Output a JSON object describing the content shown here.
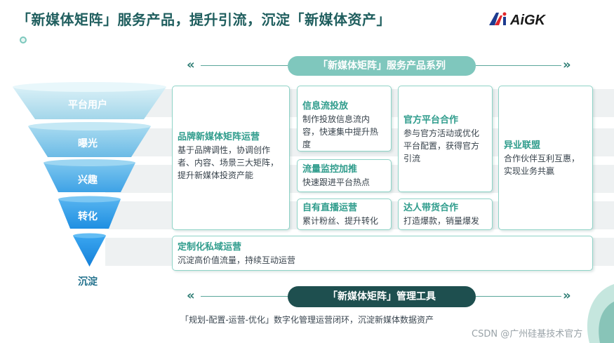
{
  "title": "「新媒体矩阵」服务产品，提升引流，沉淀「新媒体资产」",
  "logo_text": "AiGK",
  "funnel": [
    {
      "label": "平台用户"
    },
    {
      "label": "曝光"
    },
    {
      "label": "兴趣"
    },
    {
      "label": "转化"
    },
    {
      "label": "沉淀"
    }
  ],
  "top_banner": "「新媒体矩阵」服务产品系列",
  "cards": {
    "brand": {
      "title": "品牌新媒体矩阵运营",
      "desc": "基于品牌调性，协调创作者、内容、场景三大矩阵，提升新媒体投资产能"
    },
    "feed": {
      "title": "信息流投放",
      "desc": "制作投放信息流内容，快速集中提升热度"
    },
    "official": {
      "title": "官方平台合作",
      "desc": "参与官方活动或优化平台配置，获得官方引流"
    },
    "alliance": {
      "title": "异业联盟",
      "desc": "合作伙伴互利互惠，实现业务共赢"
    },
    "traffic": {
      "title": "流量监控加推",
      "desc": "快速跟进平台热点"
    },
    "live": {
      "title": "自有直播运营",
      "desc": "累计粉丝、提升转化"
    },
    "influencer": {
      "title": "达人带货合作",
      "desc": "打造爆款，销量爆发"
    },
    "private": {
      "title": "定制化私域运营",
      "desc": "沉淀高价值流量，持续互动运营"
    }
  },
  "bottom_banner": "「新媒体矩阵」管理工具",
  "bottom_desc": "「规划-配置-运营-优化」数字化管理运营闭环，沉淀新媒体数据资产",
  "watermark": "CSDN @广州硅基技术官方",
  "colors": {
    "accent": "#2f9c8c",
    "dark": "#1e4f4f",
    "pill": "#7fc7bd",
    "funnel_top": "#a9dcea",
    "funnel_bottom": "#1b8fe0"
  }
}
